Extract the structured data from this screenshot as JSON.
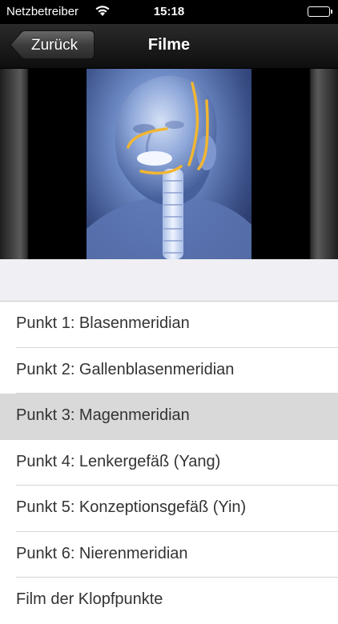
{
  "status_bar": {
    "carrier": "Netzbetreiber",
    "time": "15:18",
    "wifi_icon": "wifi-icon",
    "battery_icon": "battery-icon"
  },
  "nav": {
    "back_label": "Zurück",
    "title": "Filme"
  },
  "video": {
    "icon": "acupuncture-meridian-video"
  },
  "list": {
    "items": [
      {
        "label": "Punkt 1: Blasenmeridian",
        "selected": false
      },
      {
        "label": "Punkt 2: Gallenblasenmeridian",
        "selected": false
      },
      {
        "label": "Punkt 3: Magenmeridian",
        "selected": true
      },
      {
        "label": "Punkt 4: Lenkergefäß (Yang)",
        "selected": false
      },
      {
        "label": "Punkt 5: Konzeptionsgefäß (Yin)",
        "selected": false
      },
      {
        "label": "Punkt 6: Nierenmeridian",
        "selected": false
      },
      {
        "label": "Film der Klopfpunkte",
        "selected": false
      }
    ]
  },
  "colors": {
    "selected_row": "#d9d9d9",
    "meridian_line": "#f2b632",
    "nav_background": "#1a1a1a"
  }
}
